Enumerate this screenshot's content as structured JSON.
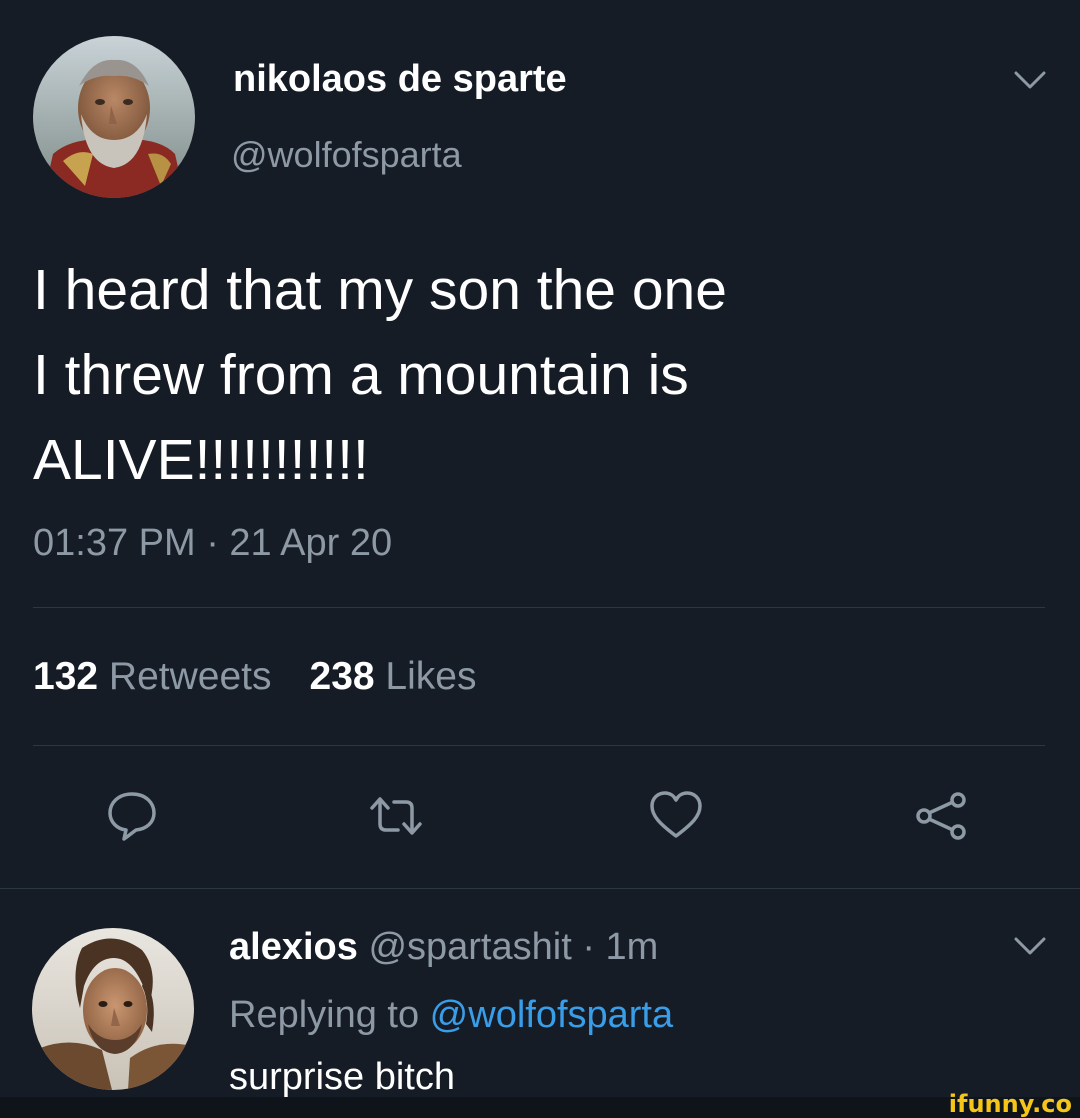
{
  "tweet": {
    "author": {
      "display_name": "nikolaos de sparte",
      "handle": "@wolfofsparta",
      "avatar": "bearded-man-avatar"
    },
    "text_lines": [
      "I heard that my son the one",
      "I threw from a mountain is",
      "ALIVE!!!!!!!!!!!"
    ],
    "timestamp": "01:37 PM · 21 Apr 20",
    "stats": {
      "retweets_count": "132",
      "retweets_label": "Retweets",
      "likes_count": "238",
      "likes_label": "Likes"
    },
    "actions": [
      "reply-icon",
      "retweet-icon",
      "like-icon",
      "share-icon"
    ],
    "menu_icon": "chevron-down-icon"
  },
  "reply": {
    "display_name": "alexios",
    "handle": "@spartashit",
    "separator": " · ",
    "time": "1m",
    "replying_prefix": "Replying to ",
    "replying_handle": "@wolfofsparta",
    "text": "surprise bitch",
    "avatar": "young-man-avatar",
    "menu_icon": "chevron-down-icon"
  },
  "watermark": "ifunny.co",
  "colors": {
    "background": "#151c26",
    "secondary_text": "#8d99a5",
    "link": "#3a9de8",
    "divider": "#2c3742",
    "watermark": "#f5c518"
  }
}
